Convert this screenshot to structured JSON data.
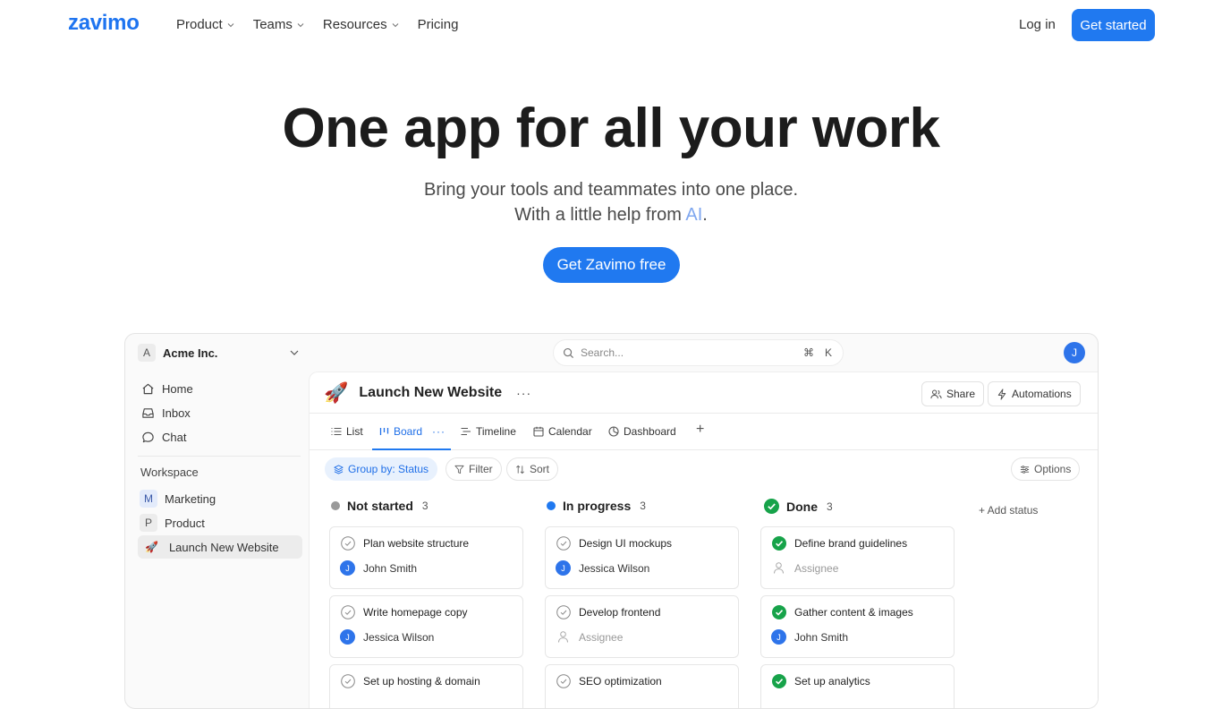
{
  "nav": {
    "logo": "zavimo",
    "menu": [
      {
        "label": "Product",
        "has_dropdown": true
      },
      {
        "label": "Teams",
        "has_dropdown": true
      },
      {
        "label": "Resources",
        "has_dropdown": true
      },
      {
        "label": "Pricing",
        "has_dropdown": false
      }
    ],
    "login": "Log in",
    "get_started": "Get started"
  },
  "hero": {
    "title": "One app for all your work",
    "subtitle_line1": "Bring your tools and teammates into one place.",
    "subtitle_line2_prefix": "With a little help from ",
    "subtitle_line2_ai": "AI",
    "subtitle_line2_suffix": ".",
    "cta": "Get Zavimo free"
  },
  "app": {
    "workspace": {
      "letter": "A",
      "name": "Acme Inc."
    },
    "search": {
      "placeholder": "Search...",
      "shortcut_mod": "⌘",
      "shortcut_key": "K"
    },
    "user_initial": "J",
    "sidebar": {
      "items": [
        {
          "label": "Home",
          "icon": "home-icon"
        },
        {
          "label": "Inbox",
          "icon": "inbox-icon"
        },
        {
          "label": "Chat",
          "icon": "chat-icon"
        }
      ],
      "section_label": "Workspace",
      "projects": [
        {
          "letter": "M",
          "label": "Marketing"
        },
        {
          "letter": "P",
          "label": "Product"
        },
        {
          "emoji": "🚀",
          "label": "Launch New Website",
          "active": true
        }
      ]
    },
    "project": {
      "emoji": "🚀",
      "title": "Launch New Website",
      "more": "···",
      "share": "Share",
      "automations": "Automations"
    },
    "tabs": [
      {
        "label": "List",
        "icon": "list-icon"
      },
      {
        "label": "Board",
        "icon": "board-icon",
        "active": true,
        "more": "···"
      },
      {
        "label": "Timeline",
        "icon": "timeline-icon"
      },
      {
        "label": "Calendar",
        "icon": "calendar-icon"
      },
      {
        "label": "Dashboard",
        "icon": "dashboard-icon"
      }
    ],
    "add_tab": "+",
    "toolbar": {
      "group_by": "Group by: Status",
      "filter": "Filter",
      "sort": "Sort",
      "options": "Options"
    },
    "add_status": "+ Add status",
    "columns": [
      {
        "name": "Not started",
        "count": "3",
        "color": "#9a9a9a",
        "cards": [
          {
            "title": "Plan website structure",
            "assignee": "John Smith",
            "initial": "J"
          },
          {
            "title": "Write homepage copy",
            "assignee": "Jessica Wilson",
            "initial": "J"
          },
          {
            "title": "Set up hosting & domain",
            "assignee": "",
            "initial": ""
          }
        ]
      },
      {
        "name": "In progress",
        "count": "3",
        "color": "#2079f0",
        "cards": [
          {
            "title": "Design UI mockups",
            "assignee": "Jessica Wilson",
            "initial": "J"
          },
          {
            "title": "Develop frontend",
            "assignee": "Assignee",
            "initial": "",
            "placeholder": true
          },
          {
            "title": "SEO optimization",
            "assignee": "",
            "initial": ""
          }
        ]
      },
      {
        "name": "Done",
        "count": "3",
        "color": "#17a34a",
        "cards": [
          {
            "title": "Define brand guidelines",
            "assignee": "Assignee",
            "initial": "",
            "placeholder": true
          },
          {
            "title": "Gather content & images",
            "assignee": "John Smith",
            "initial": "J"
          },
          {
            "title": "Set up analytics",
            "assignee": "",
            "initial": ""
          }
        ]
      }
    ]
  }
}
